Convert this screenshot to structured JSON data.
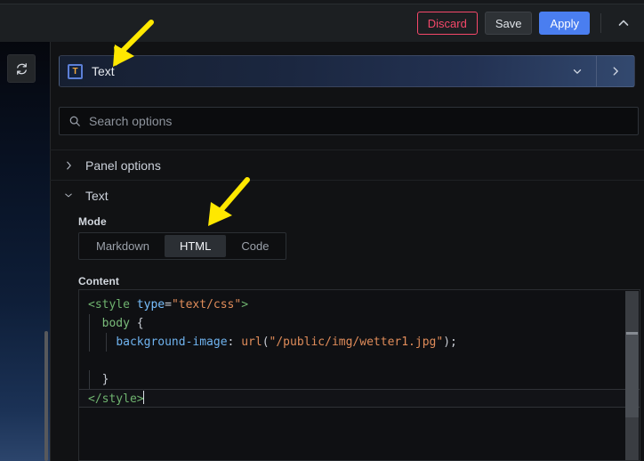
{
  "toolbar": {
    "discard_label": "Discard",
    "save_label": "Save",
    "apply_label": "Apply",
    "collapse_icon": "chevron-up-icon",
    "colors": {
      "discard": "#f5486a",
      "apply": "#4a7ef0",
      "save_bg": "#2e3236"
    }
  },
  "refresh": {
    "icon": "refresh-icon"
  },
  "vis_picker": {
    "icon_letter": "T",
    "icon_name": "text-panel-icon",
    "title": "Text",
    "expand_icon": "chevron-down-icon",
    "next_icon": "chevron-right-icon"
  },
  "search": {
    "placeholder": "Search options",
    "value": "",
    "icon": "search-icon"
  },
  "sections": [
    {
      "label": "Panel options",
      "expanded": false,
      "chevron": "chevron-right-icon"
    },
    {
      "label": "Text",
      "expanded": true,
      "chevron": "chevron-down-icon"
    }
  ],
  "mode_field": {
    "label": "Mode",
    "options": [
      "Markdown",
      "HTML",
      "Code"
    ],
    "selected": "HTML"
  },
  "content_field": {
    "label": "Content",
    "lines": [
      {
        "indent": 0,
        "tokens": [
          {
            "t": "<style",
            "c": "tag"
          },
          {
            "t": " ",
            "c": "punc"
          },
          {
            "t": "type",
            "c": "attr"
          },
          {
            "t": "=",
            "c": "punc"
          },
          {
            "t": "\"text/css\"",
            "c": "str"
          },
          {
            "t": ">",
            "c": "tag"
          }
        ]
      },
      {
        "indent": 1,
        "tokens": [
          {
            "t": "body",
            "c": "sel"
          },
          {
            "t": " {",
            "c": "punc"
          }
        ]
      },
      {
        "indent": 2,
        "tokens": [
          {
            "t": "background-image",
            "c": "prop"
          },
          {
            "t": ": ",
            "c": "punc"
          },
          {
            "t": "url",
            "c": "fn"
          },
          {
            "t": "(",
            "c": "punc"
          },
          {
            "t": "\"/public/img/wetter1.jpg\"",
            "c": "str"
          },
          {
            "t": ");",
            "c": "punc"
          }
        ]
      },
      {
        "indent": 0,
        "tokens": []
      },
      {
        "indent": 1,
        "tokens": [
          {
            "t": "}",
            "c": "punc"
          }
        ]
      },
      {
        "indent": 0,
        "active": true,
        "tokens": [
          {
            "t": "</style>",
            "c": "tag"
          }
        ]
      }
    ],
    "plain_text": "<style type=\"text/css\">\n  body {\n    background-image: url(\"/public/img/wetter1.jpg\");\n\n  }\n</style>"
  },
  "annotations": [
    {
      "name": "arrow-to-panel-title",
      "color": "#ffe800",
      "direction": "down-left"
    },
    {
      "name": "arrow-to-html-mode",
      "color": "#ffe800",
      "direction": "down-left"
    }
  ]
}
